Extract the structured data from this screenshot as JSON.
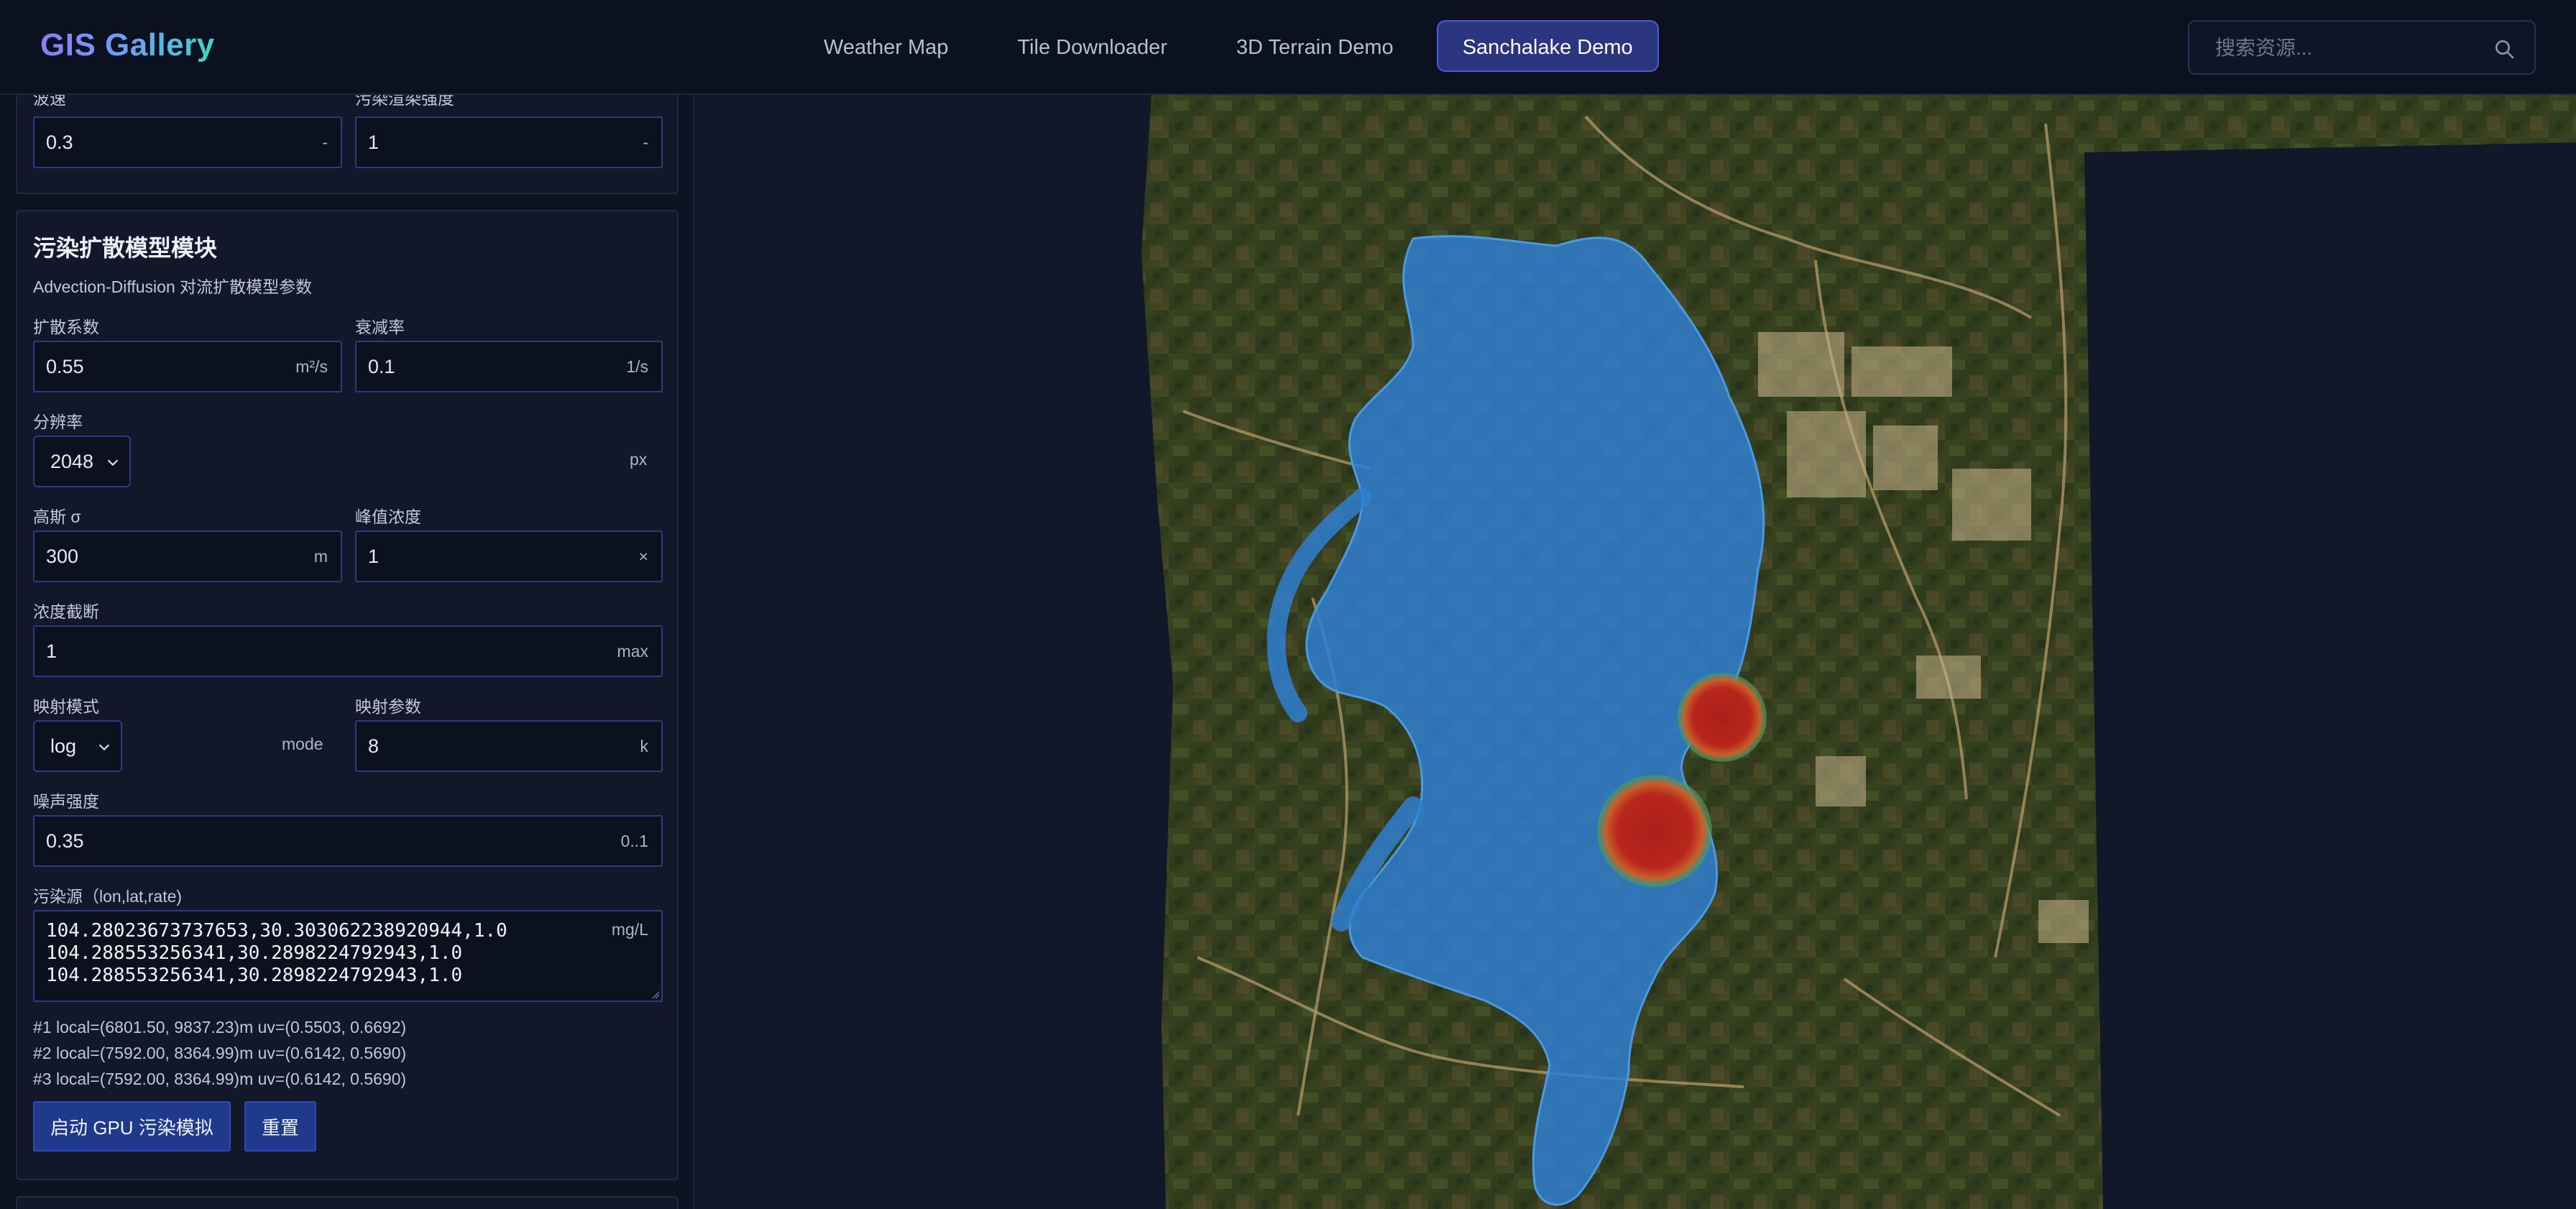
{
  "brand": "GIS Gallery",
  "nav": {
    "tabs": [
      {
        "label": "Weather Map",
        "active": false
      },
      {
        "label": "Tile Downloader",
        "active": false
      },
      {
        "label": "3D Terrain Demo",
        "active": false
      },
      {
        "label": "Sanchalake Demo",
        "active": true
      }
    ],
    "search_placeholder": "搜索资源..."
  },
  "wave_card": {
    "speed_label": "波速",
    "speed_value": "0.3",
    "speed_unit": "-",
    "intensity_label": "污染渲染强度",
    "intensity_value": "1",
    "intensity_unit": "-"
  },
  "model": {
    "title": "污染扩散模型模块",
    "subtitle": "Advection-Diffusion 对流扩散模型参数",
    "diffusion_label": "扩散系数",
    "diffusion_value": "0.55",
    "diffusion_unit": "m²/s",
    "decay_label": "衰减率",
    "decay_value": "0.1",
    "decay_unit": "1/s",
    "resolution_label": "分辨率",
    "resolution_value": "2048",
    "resolution_unit": "px",
    "sigma_label": "高斯 σ",
    "sigma_value": "300",
    "sigma_unit": "m",
    "peak_label": "峰值浓度",
    "peak_value": "1",
    "peak_unit": "×",
    "cutoff_label": "浓度截断",
    "cutoff_value": "1",
    "cutoff_unit": "max",
    "mapping_mode_label": "映射模式",
    "mapping_mode_value": "log",
    "mapping_mode_unit": "mode",
    "mapping_param_label": "映射参数",
    "mapping_param_value": "8",
    "mapping_param_unit": "k",
    "noise_label": "噪声强度",
    "noise_value": "0.35",
    "noise_unit": "0..1",
    "sources_label": "污染源（lon,lat,rate)",
    "sources_value": "104.28023673737653,30.303062238920944,1.0\n104.288553256341,30.2898224792943,1.0\n104.288553256341,30.2898224792943,1.0",
    "sources_unit": "mg/L",
    "source_info": [
      "#1 local=(6801.50, 9837.23)m uv=(0.5503, 0.6692)",
      "#2 local=(7592.00, 8364.99)m uv=(0.6142, 0.5690)",
      "#3 local=(7592.00, 8364.99)m uv=(0.6142, 0.5690)"
    ],
    "start_button": "启动 GPU 污染模拟",
    "reset_button": "重置"
  },
  "colors": {
    "accent": "#2b3580",
    "water": "#2f7fd0",
    "pollution": "#b8261c",
    "terrain": "#35401f"
  }
}
